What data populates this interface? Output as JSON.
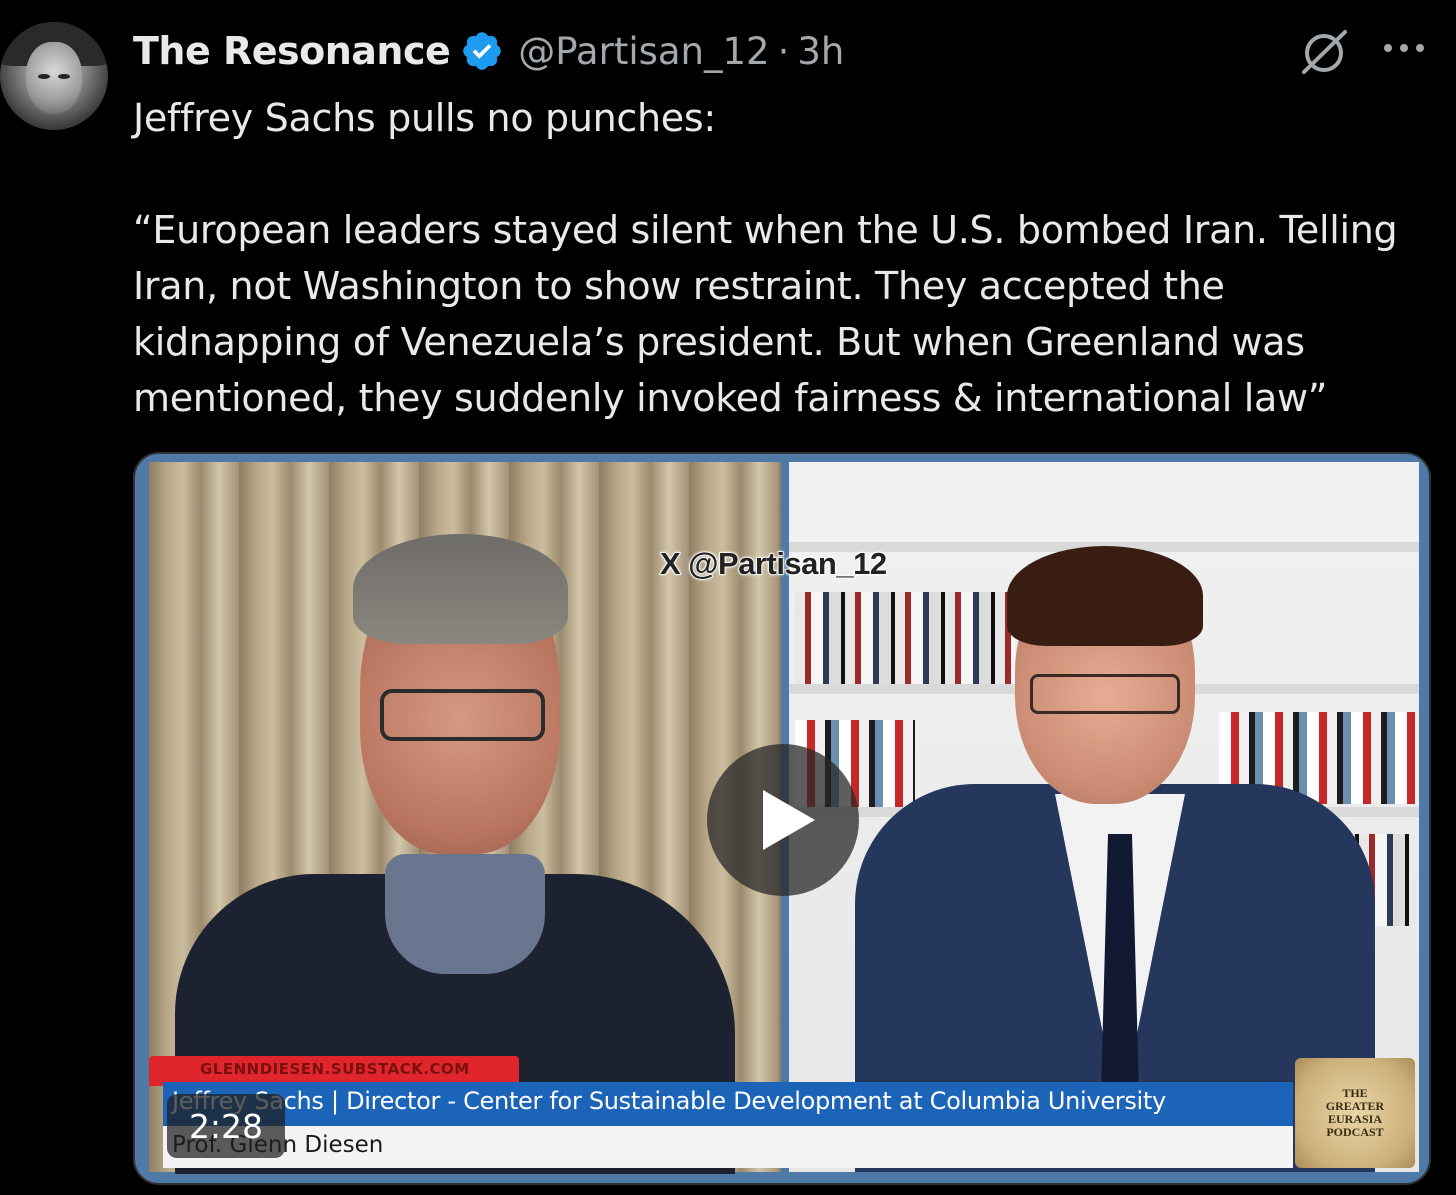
{
  "post": {
    "author": {
      "display_name": "The Resonance",
      "handle": "@Partisan_12",
      "verified": true,
      "separator": "·",
      "time": "3h"
    },
    "text": "Jeffrey Sachs pulls no punches:\n\n“European leaders stayed silent when the U.S. bombed Iran. Telling\nIran, not Washington to show restraint. They accepted the\nkidnapping of Venezuela’s president. But when Greenland was\nmentioned, they suddenly invoked fairness & international law”",
    "actions": {
      "grok_icon": "grok-icon",
      "more_icon": "more-icon"
    }
  },
  "media": {
    "type": "video",
    "duration": "2:28",
    "watermark": "X @Partisan_12",
    "lower_third": {
      "site": "GLENNDIESEN.SUBSTACK.COM",
      "line1": "Jeffrey Sachs | Director - Center for Sustainable Development at Columbia University",
      "line2": "Prof. Glenn Diesen"
    },
    "podcast_logo": {
      "top": "THE",
      "line1": "GREATER",
      "line2": "EURASIA",
      "bottom": "PODCAST"
    }
  },
  "colors": {
    "background": "#000000",
    "text": "#e7e9ea",
    "secondary_text": "#a3a8ad",
    "verified_blue": "#1d9bf0",
    "lower_third_blue": "#1c64b8",
    "lower_third_red": "#e0262c"
  }
}
